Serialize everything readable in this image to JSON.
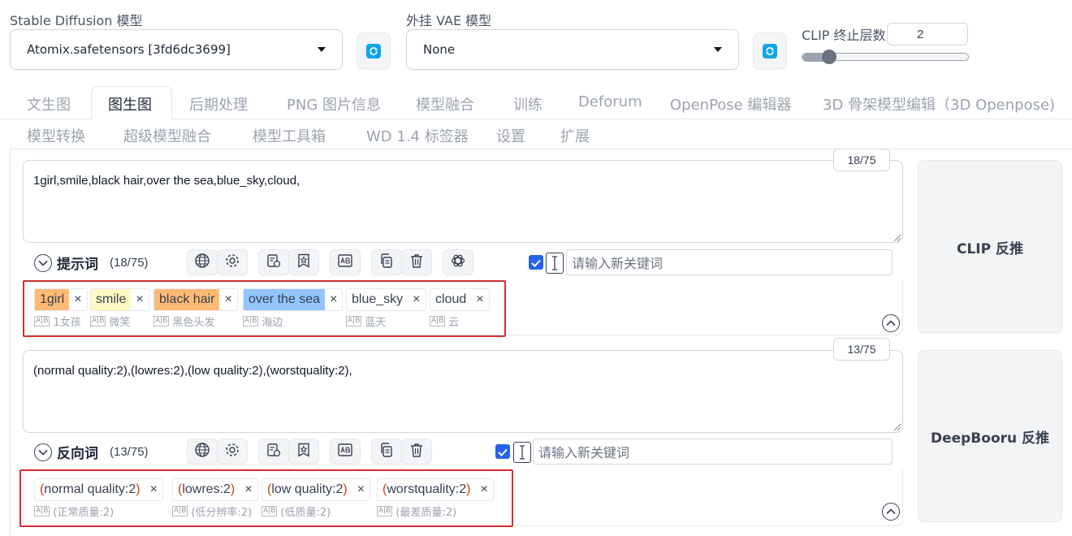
{
  "models": {
    "sd_label": "Stable Diffusion 模型",
    "sd_value": "Atomix.safetensors [3fd6dc3699]",
    "vae_label": "外挂 VAE 模型",
    "vae_value": "None",
    "clip_label": "CLIP 终止层数",
    "clip_value": "2",
    "clip_slider_fraction": 0.12
  },
  "tabs_row1": [
    "文生图",
    "图生图",
    "后期处理",
    "PNG 图片信息",
    "模型融合",
    "训练",
    "Deforum",
    "OpenPose 编辑器",
    "3D 骨架模型编辑（3D Openpose)"
  ],
  "tabs_row2": [
    "模型转换",
    "超级模型融合",
    "模型工具箱",
    "WD 1.4 标签器",
    "设置",
    "扩展"
  ],
  "active_tab": "图生图",
  "prompt": {
    "text": "1girl,smile,black hair,over the sea,blue_sky,cloud,",
    "counter": "18/75",
    "title": "提示词",
    "count": "(18/75)",
    "keyword_placeholder": "请输入新关键词",
    "tags": [
      {
        "text": "1girl",
        "translation": "1女孩",
        "bg": "#fdba74"
      },
      {
        "text": "smile",
        "translation": "微笑",
        "bg": "#fef9c3"
      },
      {
        "text": "black hair",
        "translation": "黑色头发",
        "bg": "#fdba74"
      },
      {
        "text": "over the sea",
        "translation": "海边",
        "bg": "#93c5fd"
      },
      {
        "text": "blue_sky",
        "translation": "蓝天",
        "bg": "#ffffff"
      },
      {
        "text": "cloud",
        "translation": "云",
        "bg": "#ffffff"
      }
    ]
  },
  "negative": {
    "text": "(normal quality:2),(lowres:2),(low quality:2),(worstquality:2),",
    "counter": "13/75",
    "title": "反向词",
    "count": "(13/75)",
    "keyword_placeholder": "请输入新关键词",
    "tags": [
      {
        "open": "(",
        "inner": "normal quality:2",
        "close": ")",
        "translation": "(正常质量:2)"
      },
      {
        "open": "(",
        "inner": "lowres:2",
        "close": ")",
        "translation": "(低分辨率:2)"
      },
      {
        "open": "(",
        "inner": "low quality:2",
        "close": ")",
        "translation": "(低质量:2)"
      },
      {
        "open": "(",
        "inner": "worstquality:2",
        "close": ")",
        "translation": "(最差质量:2)"
      }
    ]
  },
  "buttons": {
    "clip_interrogate": "CLIP 反推",
    "deepbooru_interrogate": "DeepBooru 反推"
  },
  "remove_glyph": "×",
  "colors": {
    "highlight_box": "#d32f2f",
    "accent": "#2563eb",
    "refresh": "#0ea5e9"
  }
}
